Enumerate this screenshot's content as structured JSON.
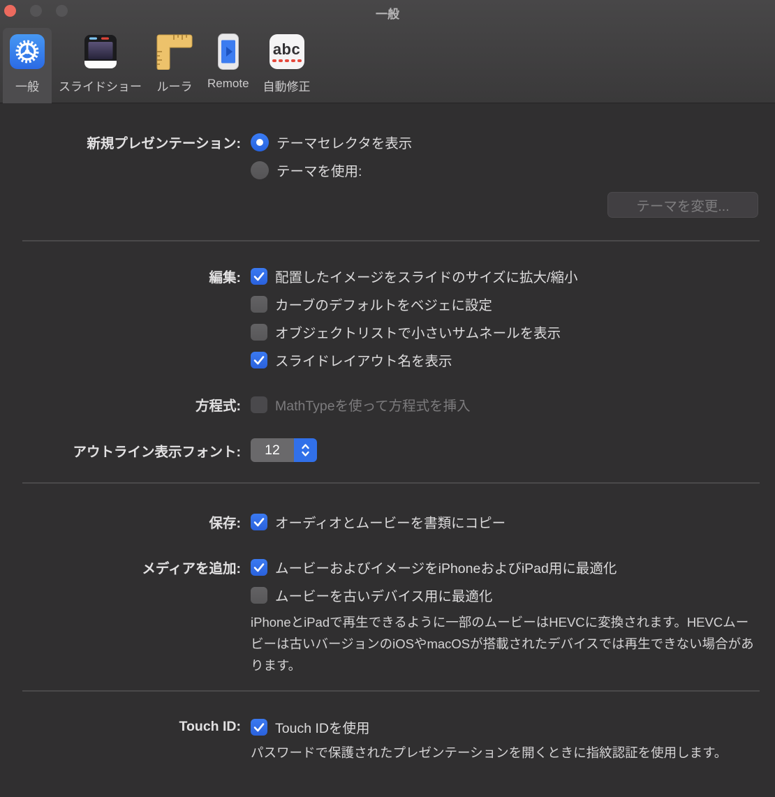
{
  "window": {
    "title": "一般"
  },
  "toolbar": {
    "items": [
      {
        "label": "一般",
        "icon": "gear-icon",
        "selected": true
      },
      {
        "label": "スライドショー",
        "icon": "slideshow-icon",
        "selected": false
      },
      {
        "label": "ルーラ",
        "icon": "ruler-icon",
        "selected": false
      },
      {
        "label": "Remote",
        "icon": "remote-icon",
        "selected": false
      },
      {
        "label": "自動修正",
        "icon": "autocorrect-icon",
        "icon_text": "abc",
        "selected": false
      }
    ]
  },
  "form": {
    "new_presentation": {
      "label": "新規プレゼンテーション:",
      "options": [
        {
          "label": "テーマセレクタを表示",
          "selected": true
        },
        {
          "label": "テーマを使用:",
          "selected": false
        }
      ],
      "change_theme_button": {
        "label": "テーマを変更...",
        "disabled": true
      }
    },
    "editing": {
      "label": "編集:",
      "options": [
        {
          "label": "配置したイメージをスライドのサイズに拡大/縮小",
          "checked": true
        },
        {
          "label": "カーブのデフォルトをベジェに設定",
          "checked": false
        },
        {
          "label": "オブジェクトリストで小さいサムネールを表示",
          "checked": false
        },
        {
          "label": "スライドレイアウト名を表示",
          "checked": true
        }
      ]
    },
    "equation": {
      "label": "方程式:",
      "option": {
        "label": "MathTypeを使って方程式を挿入",
        "checked": false,
        "disabled": true
      }
    },
    "outline_font": {
      "label": "アウトライン表示フォント:",
      "value": "12"
    },
    "save": {
      "label": "保存:",
      "option": {
        "label": "オーディオとムービーを書類にコピー",
        "checked": true
      }
    },
    "add_media": {
      "label": "メディアを追加:",
      "options": [
        {
          "label": "ムービーおよびイメージをiPhoneおよびiPad用に最適化",
          "checked": true
        },
        {
          "label": "ムービーを古いデバイス用に最適化",
          "checked": false
        }
      ],
      "note": "iPhoneとiPadで再生できるように一部のムービーはHEVCに変換されます。HEVCムービーは古いバージョンのiOSやmacOSが搭載されたデバイスでは再生できない場合があります。"
    },
    "touch_id": {
      "label": "Touch ID:",
      "option": {
        "label": "Touch IDを使用",
        "checked": true
      },
      "note": "パスワードで保護されたプレゼンテーションを開くときに指紋認証を使用します。"
    }
  },
  "colors": {
    "accent_blue": "#2f6fe6",
    "header_top": "#484748",
    "header_bottom": "#3a393a",
    "content_bg": "#302f30",
    "divider": "#4a494a",
    "label_text": "#e2e1e2",
    "option_text": "#dcdbdc",
    "disabled_text": "#7c7b7d",
    "note_text": "#d4d3d4",
    "close_red": "#ec6a5e",
    "ruler_yellow": "#edc26b",
    "autocorrect_red": "#e5483c"
  }
}
